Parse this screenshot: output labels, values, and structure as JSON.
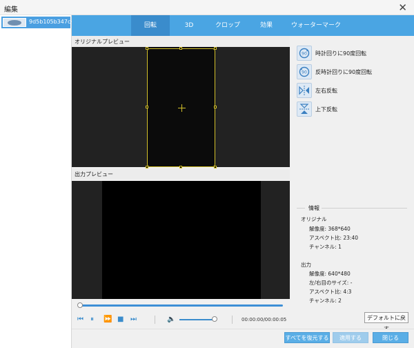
{
  "window": {
    "title": "編集",
    "close_icon": "close-icon"
  },
  "file_list": [
    {
      "name": "9d5b105b347c···",
      "selected": true
    }
  ],
  "tabs": [
    {
      "label": "回転",
      "active": true
    },
    {
      "label": "3D",
      "active": false
    },
    {
      "label": "クロップ",
      "active": false
    },
    {
      "label": "効果",
      "active": false
    },
    {
      "label": "ウォーターマーク",
      "active": false
    }
  ],
  "previews": {
    "original_label": "オリジナルプレビュー",
    "output_label": "出力プレビュー"
  },
  "player": {
    "timecode": "00:00:00/00:00:05",
    "seek_fraction": 0,
    "volume_fraction": 0.88,
    "icons": [
      "skip-back-icon",
      "pause-icon",
      "fast-forward-icon",
      "stop-icon",
      "skip-forward-icon",
      "volume-icon"
    ]
  },
  "rotate_actions": [
    {
      "label": "時計回りに90度回転",
      "icon": "rotate-clockwise-icon"
    },
    {
      "label": "反時計回りに90度回転",
      "icon": "rotate-counterclockwise-icon"
    },
    {
      "label": "左右反転",
      "icon": "flip-horizontal-icon"
    },
    {
      "label": "上下反転",
      "icon": "flip-vertical-icon"
    }
  ],
  "info": {
    "heading": "情報",
    "original": {
      "title": "オリジナル",
      "resolution": "解像度: 368*640",
      "aspect": "アスペクト比: 23:40",
      "channels": "チャンネル: 1"
    },
    "output": {
      "title": "出力",
      "resolution": "解像度: 640*480",
      "side_size": "左/右目のサイズ: -",
      "aspect": "アスペクト比: 4:3",
      "channels": "チャンネル: 2"
    }
  },
  "buttons": {
    "default": "デフォルトに戻す",
    "restore_all": "すべてを復元する",
    "apply": "適用する",
    "close": "閉じる"
  },
  "colors": {
    "accent": "#4aa5e3",
    "active_tab": "#3a8ccc",
    "crop_frame": "#d4c12a"
  }
}
